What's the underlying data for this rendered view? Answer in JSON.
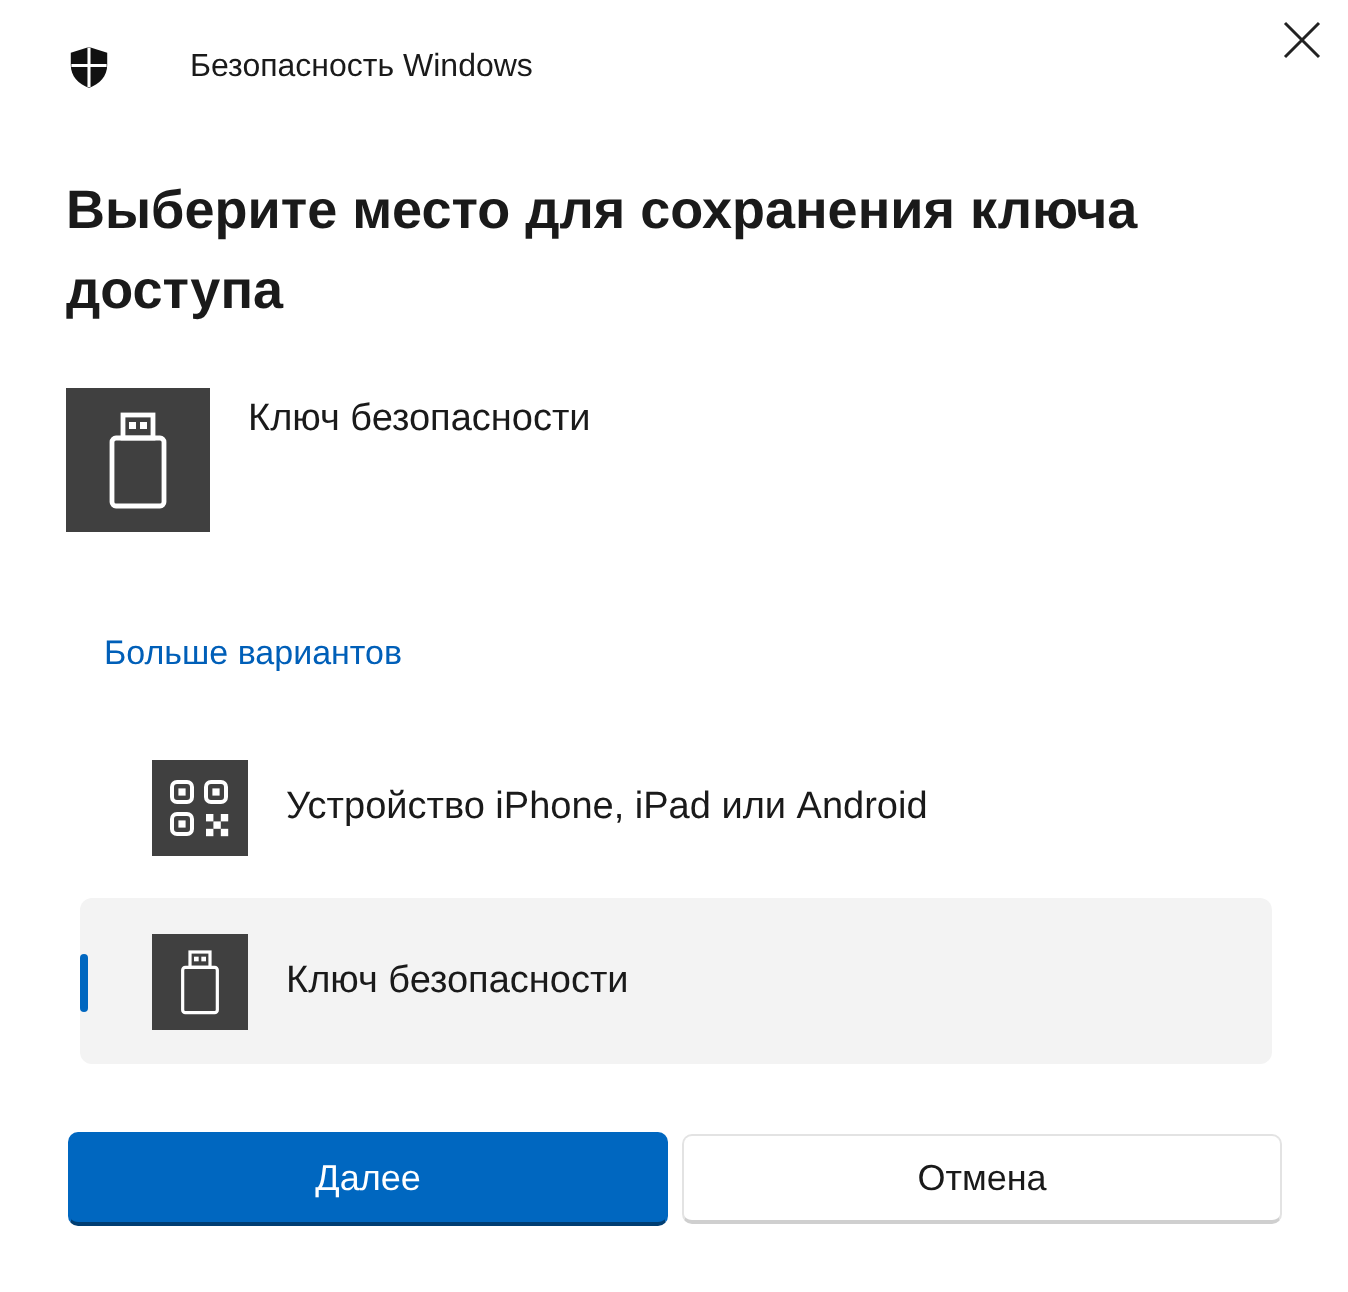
{
  "window": {
    "title": "Безопасность Windows"
  },
  "heading": "Выберите место для сохранения ключа доступа",
  "chosen_method": {
    "label": "Ключ безопасности",
    "kind": "usb"
  },
  "more_options_link": "Больше вариантов",
  "options": [
    {
      "label": "Устройство iPhone, iPad или Android",
      "kind": "qr",
      "selected": false
    },
    {
      "label": "Ключ безопасности",
      "kind": "usb",
      "selected": true
    }
  ],
  "buttons": [
    {
      "label": "Далее",
      "kind": "primary"
    },
    {
      "label": "Отмена",
      "kind": "secondary"
    }
  ]
}
